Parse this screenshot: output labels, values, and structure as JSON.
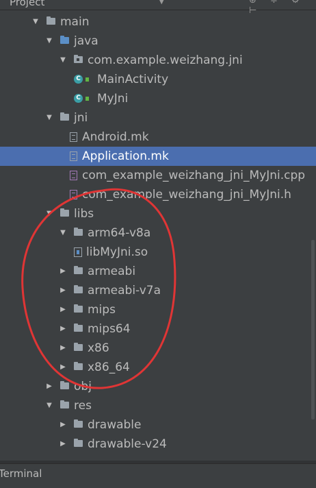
{
  "header": {
    "title": "Project"
  },
  "tree": [
    {
      "label": "main",
      "icon": "folder",
      "arrow": "down",
      "depth": 0
    },
    {
      "label": "java",
      "icon": "java-folder",
      "arrow": "down",
      "depth": 1
    },
    {
      "label": "com.example.weizhang.jni",
      "icon": "package",
      "arrow": "down",
      "depth": 2
    },
    {
      "label": "MainActivity",
      "icon": "class",
      "arrow": "none",
      "depth": 3
    },
    {
      "label": "MyJni",
      "icon": "class",
      "arrow": "none",
      "depth": 3
    },
    {
      "label": "jni",
      "icon": "folder",
      "arrow": "down",
      "depth": 1
    },
    {
      "label": "Android.mk",
      "icon": "file",
      "arrow": "none",
      "depth": 2
    },
    {
      "label": "Application.mk",
      "icon": "file",
      "arrow": "none",
      "depth": 2,
      "selected": true
    },
    {
      "label": "com_example_weizhang_jni_MyJni.cpp",
      "icon": "cpp-file",
      "arrow": "none",
      "depth": 2
    },
    {
      "label": "com_example_weizhang_jni_MyJni.h",
      "icon": "h-file",
      "arrow": "none",
      "depth": 2
    },
    {
      "label": "libs",
      "icon": "folder",
      "arrow": "down",
      "depth": 1
    },
    {
      "label": "arm64-v8a",
      "icon": "folder",
      "arrow": "down",
      "depth": 2
    },
    {
      "label": "libMyJni.so",
      "icon": "library",
      "arrow": "none",
      "depth": 3
    },
    {
      "label": "armeabi",
      "icon": "folder",
      "arrow": "right",
      "depth": 2
    },
    {
      "label": "armeabi-v7a",
      "icon": "folder",
      "arrow": "right",
      "depth": 2
    },
    {
      "label": "mips",
      "icon": "folder",
      "arrow": "right",
      "depth": 2
    },
    {
      "label": "mips64",
      "icon": "folder",
      "arrow": "right",
      "depth": 2
    },
    {
      "label": "x86",
      "icon": "folder",
      "arrow": "right",
      "depth": 2
    },
    {
      "label": "x86_64",
      "icon": "folder",
      "arrow": "right",
      "depth": 2
    },
    {
      "label": "obj",
      "icon": "folder",
      "arrow": "right",
      "depth": 1
    },
    {
      "label": "res",
      "icon": "res-folder",
      "arrow": "down",
      "depth": 1
    },
    {
      "label": "drawable",
      "icon": "folder",
      "arrow": "right",
      "depth": 2
    },
    {
      "label": "drawable-v24",
      "icon": "folder",
      "arrow": "right",
      "depth": 2
    }
  ],
  "statusbar": {
    "terminal_label": "Terminal"
  },
  "colors": {
    "background": "#3c3f41",
    "selection": "#4b6eaf",
    "annotation": "#e03535"
  }
}
